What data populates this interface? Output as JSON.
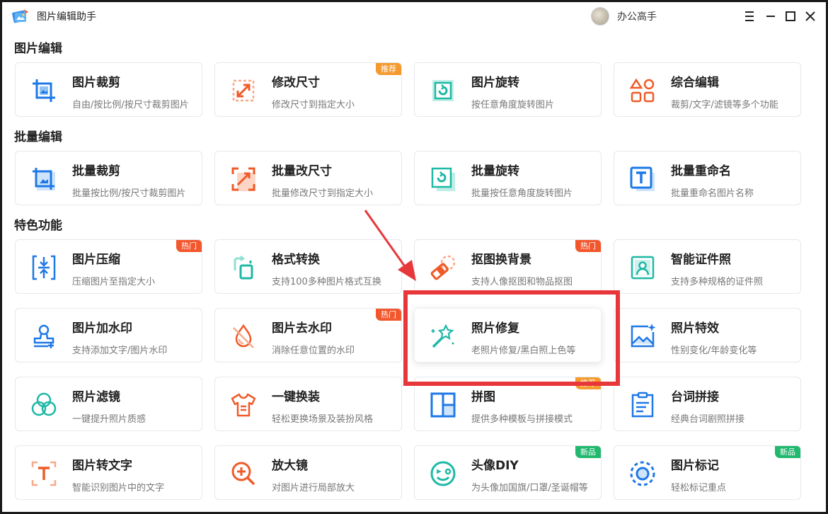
{
  "app": {
    "title": "图片编辑助手",
    "username": "办公高手"
  },
  "colors": {
    "accent_red": "#e8373b",
    "badge_orange": "#f59a2e",
    "badge_red": "#f2572d",
    "badge_green": "#22b86e"
  },
  "sections": [
    {
      "title": "图片编辑"
    },
    {
      "title": "批量编辑"
    },
    {
      "title": "特色功能"
    }
  ],
  "cards": [
    {
      "title": "图片裁剪",
      "desc": "自由/按比例/按尺寸裁剪图片",
      "badge": ""
    },
    {
      "title": "修改尺寸",
      "desc": "修改尺寸到指定大小",
      "badge": "推荐"
    },
    {
      "title": "图片旋转",
      "desc": "按任意角度旋转图片",
      "badge": ""
    },
    {
      "title": "综合编辑",
      "desc": "裁剪/文字/滤镜等多个功能",
      "badge": ""
    },
    {
      "title": "批量裁剪",
      "desc": "批量按比例/按尺寸裁剪图片",
      "badge": ""
    },
    {
      "title": "批量改尺寸",
      "desc": "批量修改尺寸到指定大小",
      "badge": ""
    },
    {
      "title": "批量旋转",
      "desc": "批量按任意角度旋转图片",
      "badge": ""
    },
    {
      "title": "批量重命名",
      "desc": "批量重命名图片名称",
      "badge": ""
    },
    {
      "title": "图片压缩",
      "desc": "压缩图片至指定大小",
      "badge": "热门"
    },
    {
      "title": "格式转换",
      "desc": "支持100多种图片格式互换",
      "badge": ""
    },
    {
      "title": "抠图换背景",
      "desc": "支持人像抠图和物品抠图",
      "badge": "热门"
    },
    {
      "title": "智能证件照",
      "desc": "支持多种规格的证件照",
      "badge": ""
    },
    {
      "title": "图片加水印",
      "desc": "支持添加文字/图片水印",
      "badge": ""
    },
    {
      "title": "图片去水印",
      "desc": "消除任意位置的水印",
      "badge": "热门"
    },
    {
      "title": "照片修复",
      "desc": "老照片修复/黑白照上色等",
      "badge": ""
    },
    {
      "title": "照片特效",
      "desc": "性别变化/年龄变化等",
      "badge": ""
    },
    {
      "title": "照片滤镜",
      "desc": "一键提升照片质感",
      "badge": ""
    },
    {
      "title": "一键换装",
      "desc": "轻松更换场景及装扮风格",
      "badge": ""
    },
    {
      "title": "拼图",
      "desc": "提供多种模板与拼接模式",
      "badge": "推荐"
    },
    {
      "title": "台词拼接",
      "desc": "经典台词剧照拼接",
      "badge": ""
    },
    {
      "title": "图片转文字",
      "desc": "智能识别图片中的文字",
      "badge": ""
    },
    {
      "title": "放大镜",
      "desc": "对图片进行局部放大",
      "badge": ""
    },
    {
      "title": "头像DIY",
      "desc": "为头像加国旗/口罩/圣诞帽等",
      "badge": "新品"
    },
    {
      "title": "图片标记",
      "desc": "轻松标记重点",
      "badge": "新品"
    }
  ]
}
